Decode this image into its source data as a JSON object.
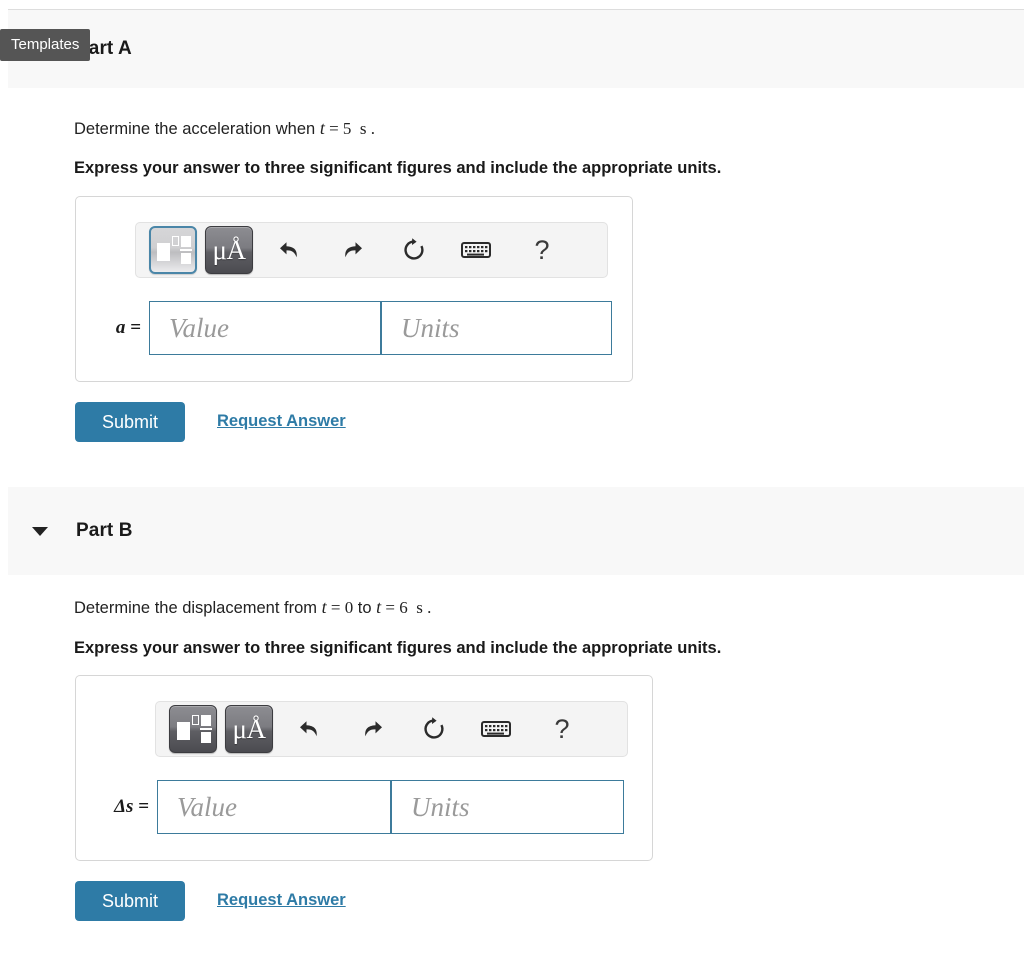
{
  "page": {
    "background": "#ffffff",
    "band_color": "#f8f8f8",
    "accent": "#2e7ba6",
    "input_border": "#3d7b9b",
    "tooltip_bg": "#555555"
  },
  "tooltip": {
    "label": "Templates"
  },
  "parts": [
    {
      "id": "part-a",
      "title": "Part A",
      "question_prefix": "Determine the acceleration when ",
      "question_var": "t",
      "question_eq": " = ",
      "question_val": "5",
      "question_unit": "s",
      "question_suffix": ".",
      "instruction": "Express your answer to three significant figures and include the appropriate units.",
      "toolbar": {
        "templates_label": "Templates",
        "templates_active": true,
        "units_label": "μÅ",
        "undo_label": "Undo",
        "redo_label": "Redo",
        "reset_label": "Reset",
        "keyboard_label": "Keyboard shortcuts",
        "help_label": "?"
      },
      "answer": {
        "label": "a =",
        "value_placeholder": "Value",
        "units_placeholder": "Units",
        "value": "",
        "units": ""
      },
      "submit_label": "Submit",
      "request_label": "Request Answer"
    },
    {
      "id": "part-b",
      "title": "Part B",
      "question_prefix": "Determine the displacement from ",
      "question_var": "t",
      "question_eq": " = ",
      "question_val": "0",
      "question_mid": " to ",
      "question_var2": "t",
      "question_eq2": " = ",
      "question_val2": "6",
      "question_unit": "s",
      "question_suffix": ".",
      "instruction": "Express your answer to three significant figures and include the appropriate units.",
      "toolbar": {
        "templates_label": "Templates",
        "templates_active": false,
        "units_label": "μÅ",
        "undo_label": "Undo",
        "redo_label": "Redo",
        "reset_label": "Reset",
        "keyboard_label": "Keyboard shortcuts",
        "help_label": "?"
      },
      "answer": {
        "label": "Δs =",
        "value_placeholder": "Value",
        "units_placeholder": "Units",
        "value": "",
        "units": ""
      },
      "submit_label": "Submit",
      "request_label": "Request Answer"
    }
  ]
}
